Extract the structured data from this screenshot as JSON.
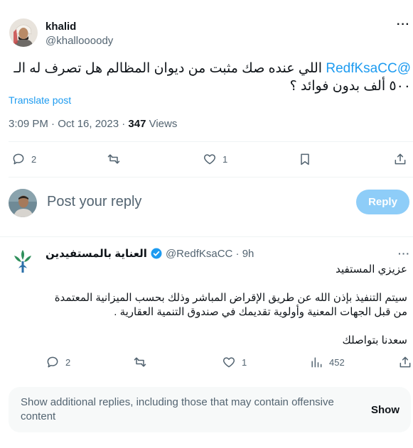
{
  "post": {
    "author_name": "khalid",
    "author_handle": "@khalloooody",
    "more_label": "···",
    "mention": "@RedfKsaCC",
    "text": "اللي عنده صك مثبت من ديوان المظالم هل تصرف له الـ ٥٠٠ ألف بدون فوائد ؟",
    "translate_label": "Translate post",
    "time": "3:09 PM · Oct 16, 2023 · ",
    "views_count": "347",
    "views_label": " Views",
    "replies_count": "2",
    "likes_count": "1"
  },
  "compose": {
    "placeholder": "Post your reply",
    "reply_label": "Reply"
  },
  "reply": {
    "name": "العناية بالمستفيدين",
    "handle": "@RedfKsaCC · 9h",
    "more_label": "···",
    "line1": "عزيزي المستفيد",
    "line2": "سيتم التنفيذ بإذن الله عن طريق الإقراض المباشر وذلك بحسب الميزانية المعتمدة من قبل الجهات المعنية وأولوية تقديمك في صندوق التنمية العقارية .",
    "line3": "سعدنا بتواصلك",
    "replies_count": "2",
    "likes_count": "1",
    "views_count": "452"
  },
  "more_replies": {
    "text": "Show additional replies, including those that may contain offensive content",
    "button_label": "Show"
  },
  "colors": {
    "accent": "#1d9bf0",
    "reply_button": "#8ecdf8",
    "secondary_text": "#536471",
    "verified_badge": "#1d9bf0"
  },
  "icons": [
    "reply-icon",
    "retweet-icon",
    "like-icon",
    "bookmark-icon",
    "share-icon",
    "views-icon",
    "verified-icon",
    "more-icon"
  ]
}
